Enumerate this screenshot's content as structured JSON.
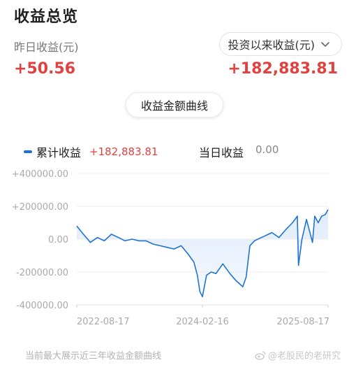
{
  "page_title": "收益总览",
  "yesterday": {
    "label": "昨日收益(元)",
    "value": "+50.56"
  },
  "total": {
    "label": "投资以来收益(元)",
    "value": "+182,883.81"
  },
  "curve_button_label": "收益金额曲线",
  "legend": {
    "series_name": "累计收益",
    "series_value": "+182,883.81",
    "today_label": "当日收益",
    "today_value": "0.00"
  },
  "footnote": "当前最大展示近三年收益金额曲线",
  "watermark": "@老股民的老研究",
  "colors": {
    "accent_red": "#e3413f",
    "line_blue": "#1e73d6",
    "fill_blue": "#dce9fb"
  },
  "chart_data": {
    "type": "area",
    "series": [
      {
        "name": "累计收益",
        "x": [
          "2022-08-17",
          "2022-09-15",
          "2022-10-15",
          "2022-11-15",
          "2022-12-15",
          "2023-01-15",
          "2023-02-15",
          "2023-03-15",
          "2023-04-15",
          "2023-05-15",
          "2023-06-15",
          "2023-07-15",
          "2023-08-15",
          "2023-09-15",
          "2023-10-15",
          "2023-11-15",
          "2023-12-15",
          "2024-01-10",
          "2024-01-25",
          "2024-02-05",
          "2024-02-16",
          "2024-03-05",
          "2024-03-25",
          "2024-04-15",
          "2024-05-15",
          "2024-06-15",
          "2024-07-10",
          "2024-07-25",
          "2024-08-10",
          "2024-08-25",
          "2024-09-10",
          "2024-09-30",
          "2024-10-15",
          "2024-11-15",
          "2024-12-15",
          "2025-01-15",
          "2025-02-15",
          "2025-03-15",
          "2025-04-05",
          "2025-04-10",
          "2025-04-25",
          "2025-05-15",
          "2025-06-10",
          "2025-06-20",
          "2025-07-05",
          "2025-07-20",
          "2025-08-05",
          "2025-08-17"
        ],
        "values": [
          80000,
          30000,
          -20000,
          10000,
          -10000,
          30000,
          10000,
          -10000,
          0,
          -10000,
          -10000,
          -30000,
          -40000,
          -50000,
          -60000,
          -40000,
          -90000,
          -140000,
          -220000,
          -320000,
          -350000,
          -220000,
          -200000,
          -210000,
          -150000,
          -210000,
          -250000,
          -270000,
          -290000,
          -230000,
          -40000,
          -10000,
          0,
          20000,
          40000,
          10000,
          60000,
          100000,
          140000,
          -160000,
          0,
          120000,
          -20000,
          140000,
          100000,
          140000,
          150000,
          180000
        ]
      }
    ],
    "xlabels": [
      "2022-08-17",
      "2024-02-16",
      "2025-08-17"
    ],
    "yticks": [
      "+400000.00",
      "+200000.00",
      "0.00",
      "-200000.00",
      "-400000.00"
    ],
    "ylim": [
      -400000,
      400000
    ],
    "grid": true,
    "legend": "top-left"
  }
}
